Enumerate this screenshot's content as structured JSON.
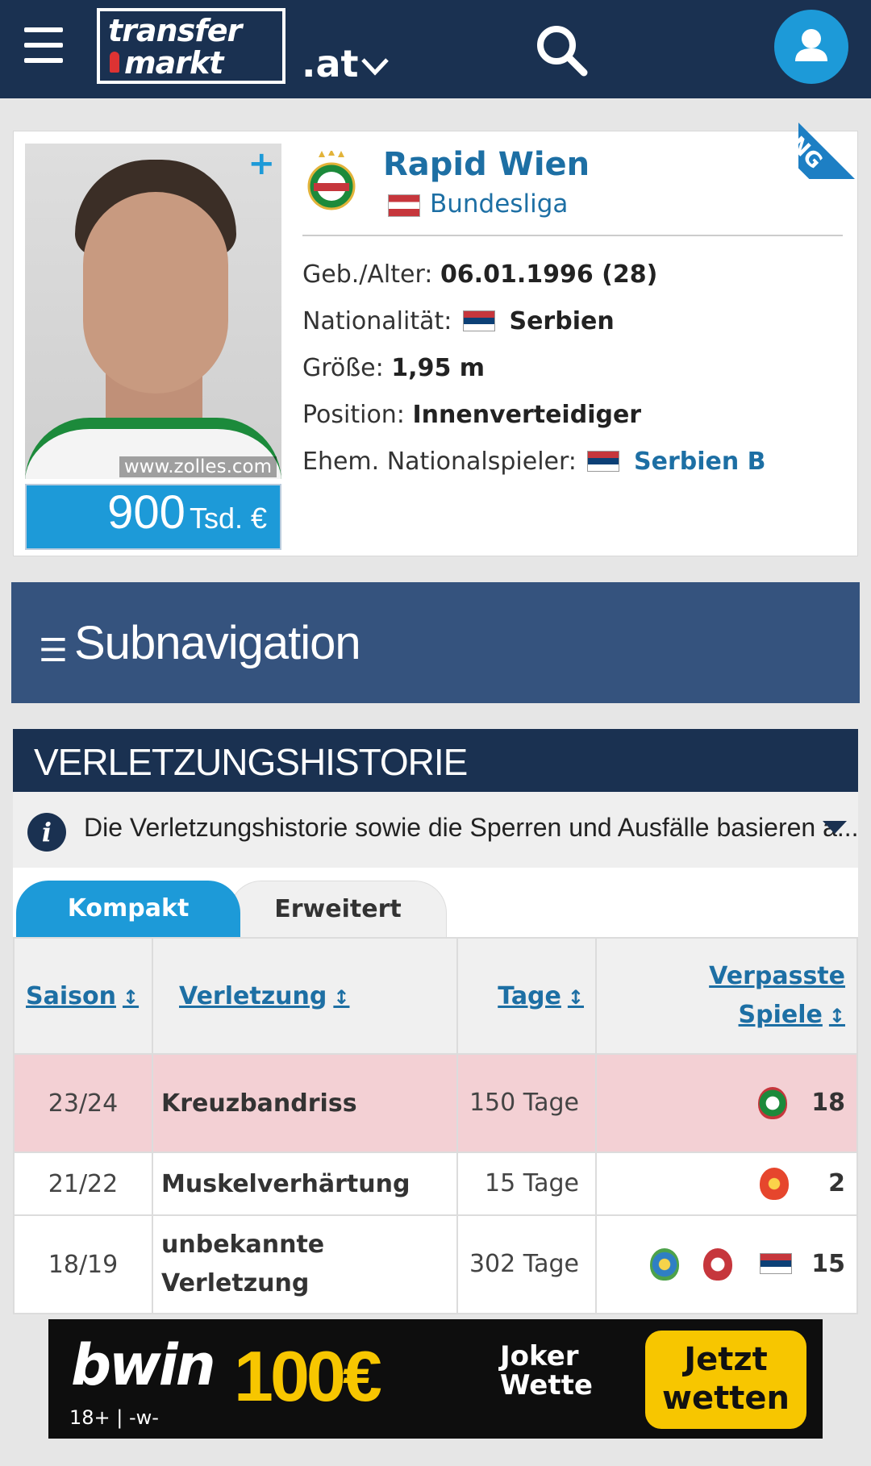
{
  "header": {
    "logo_line1": "transfer",
    "logo_line2": "markt",
    "domain": ".at"
  },
  "ribbon": {
    "text": "NG"
  },
  "profile": {
    "photo_credit": "www.zolles.com",
    "market_value": {
      "amount": "900",
      "unit": "Tsd. €"
    },
    "club": {
      "name": "Rapid Wien",
      "league": "Bundesliga"
    },
    "rows": [
      {
        "label": "Geb./Alter:",
        "value": "06.01.1996 (28)"
      },
      {
        "label": "Nationalität:",
        "value": "Serbien"
      },
      {
        "label": "Größe:",
        "value": "1,95 m"
      },
      {
        "label": "Position:",
        "value": "Innenverteidiger"
      },
      {
        "label": "Ehem. Nationalspieler:",
        "value": "Serbien B"
      }
    ]
  },
  "subnav": {
    "label": "Subnavigation"
  },
  "injury": {
    "title": "VERLETZUNGSHISTORIE",
    "info_text": "Die Verletzungshistorie sowie die Sperren und Ausfälle basieren a...",
    "tabs": [
      "Kompakt",
      "Erweitert"
    ],
    "columns": [
      "Saison",
      "Verletzung",
      "Tage",
      "Verpasste Spiele"
    ],
    "rows": [
      {
        "season": "23/24",
        "injury": "Kreuzbandriss",
        "days": "150 Tage",
        "games": "18",
        "highlight": true
      },
      {
        "season": "21/22",
        "injury": "Muskelverhärtung",
        "days": "15 Tage",
        "games": "2"
      },
      {
        "season": "18/19",
        "injury": "unbekannte Verletzung",
        "days": "302 Tage",
        "games": "15"
      }
    ]
  },
  "ad": {
    "brand": "bwin",
    "age": "18+ | -w-",
    "amount": "100€",
    "sub1": "Joker",
    "sub2": "Wette",
    "cta": "Jetzt wetten"
  },
  "colors": {
    "header_bg": "#1a3151",
    "accent_blue": "#1d9ad8",
    "link_blue": "#1d6fa4",
    "subnav_bg": "#35537e",
    "highlight_row": "#f3d0d4",
    "ad_yellow": "#f7c600"
  },
  "icons": [
    "menu-icon",
    "search-icon",
    "user-icon",
    "chevron-down-icon",
    "info-icon",
    "sort-icon"
  ]
}
